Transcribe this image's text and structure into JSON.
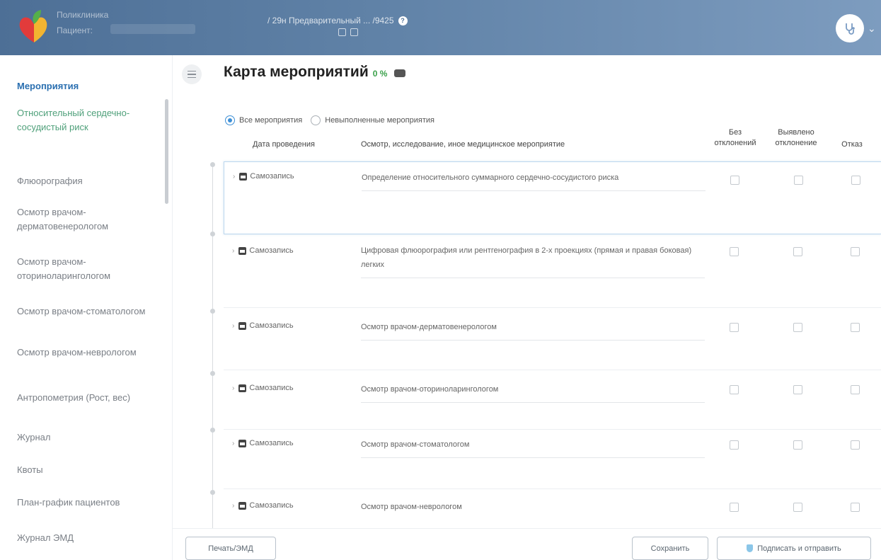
{
  "header": {
    "clinic_label": "Поликлиника",
    "patient_label": "Пациент:",
    "document_title": "/ 29н Предварительный ... /9425",
    "help_icon": "question-icon",
    "colors": {
      "header_start": "#4d6f96",
      "header_end": "#7d9cbf"
    }
  },
  "sidebar": {
    "items": [
      {
        "label": "Мероприятия",
        "state": "active"
      },
      {
        "label": "Относительный сердечно-сосудистый риск",
        "state": "sub"
      },
      {
        "label": "Флюорография"
      },
      {
        "label": "Осмотр врачом-дерматовенерологом"
      },
      {
        "label": "Осмотр врачом-оториноларингологом"
      },
      {
        "label": "Осмотр врачом-стоматологом"
      },
      {
        "label": "Осмотр врачом-неврологом"
      },
      {
        "label": "Антропометрия (Рост, вес)"
      },
      {
        "label": "Журнал"
      },
      {
        "label": "Квоты"
      },
      {
        "label": "План-график пациентов"
      },
      {
        "label": "Журнал ЭМД"
      }
    ]
  },
  "main": {
    "title": "Карта мероприятий",
    "progress": "0 %",
    "filters": {
      "all": "Все мероприятия",
      "unfinished": "Невыполненные мероприятия",
      "selected": "all"
    },
    "columns": {
      "date": "Дата проведения",
      "event": "Осмотр, исследование, иное медицинское мероприятие",
      "no_deviation": "Без отклонений",
      "deviation": "Выявлено отклонение",
      "refusal": "Отказ"
    },
    "rows": [
      {
        "date": "Самозапись",
        "event": "Определение относительного суммарного сердечно-сосудистого риска"
      },
      {
        "date": "Самозапись",
        "event": "Цифровая флюорография или рентгенография в 2-х проекциях (прямая и правая боковая) легких"
      },
      {
        "date": "Самозапись",
        "event": "Осмотр врачом-дерматовенерологом"
      },
      {
        "date": "Самозапись",
        "event": "Осмотр врачом-оториноларингологом"
      },
      {
        "date": "Самозапись",
        "event": "Осмотр врачом-стоматологом"
      },
      {
        "date": "Самозапись",
        "event": "Осмотр врачом-неврологом"
      }
    ]
  },
  "footer": {
    "print_label": "Печать/ЭМД",
    "save_label": "Сохранить",
    "sign_label": "Подписать и отправить"
  }
}
